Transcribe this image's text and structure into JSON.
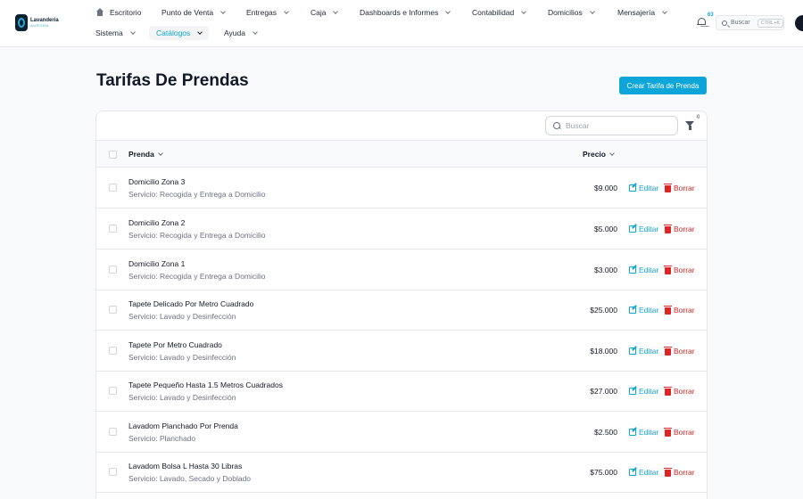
{
  "brand": {
    "line1": "Lavandería",
    "line2": "AURORA"
  },
  "nav": {
    "row1": [
      {
        "label": "Escritorio"
      },
      {
        "label": "Punto de Venta"
      },
      {
        "label": "Entregas"
      },
      {
        "label": "Caja"
      },
      {
        "label": "Dashboards e Informes"
      },
      {
        "label": "Contabilidad"
      },
      {
        "label": "Domicilios"
      },
      {
        "label": "Mensajería"
      }
    ],
    "row2": [
      {
        "label": "Sistema"
      },
      {
        "label": "Catálogos"
      },
      {
        "label": "Ayuda"
      }
    ]
  },
  "notifications": {
    "count": "63"
  },
  "global_search": {
    "label": "Buscar",
    "shortcut": "CTRL+K"
  },
  "page": {
    "title": "Tarifas De Prendas",
    "create_button": "Crear Tarifa de Prenda"
  },
  "table": {
    "search_placeholder": "Buscar",
    "filter_count": "0",
    "columns": {
      "name": "Prenda",
      "price": "Precio"
    },
    "edit_label": "Editar",
    "delete_label": "Borrar",
    "rows": [
      {
        "name": "Domicilio Zona 3",
        "service": "Servicio: Recogida y Entrega a Domicilio",
        "price": "$9.000"
      },
      {
        "name": "Domicilio Zona 2",
        "service": "Servicio: Recogida y Entrega a Domicilio",
        "price": "$5.000"
      },
      {
        "name": "Domicilio Zona 1",
        "service": "Servicio: Recogida y Entrega a Domicilio",
        "price": "$3.000"
      },
      {
        "name": "Tapete Delicado Por Metro Cuadrado",
        "service": "Servicio: Lavado y Desinfección",
        "price": "$25.000"
      },
      {
        "name": "Tapete Por Metro Cuadrado",
        "service": "Servicio: Lavado y Desinfección",
        "price": "$18.000"
      },
      {
        "name": "Tapete Pequeño Hasta 1.5 Metros Cuadrados",
        "service": "Servicio: Lavado y Desinfección",
        "price": "$27.000"
      },
      {
        "name": "Lavadom Planchado Por Prenda",
        "service": "Servicio: Planchado",
        "price": "$2.500"
      },
      {
        "name": "Lavadom Bolsa L Hasta 30 Libras",
        "service": "Servicio: Lavado, Secado y Doblado",
        "price": "$75.000"
      }
    ]
  },
  "colors": {
    "accent": "#0ea5d9",
    "danger": "#dc2626"
  }
}
